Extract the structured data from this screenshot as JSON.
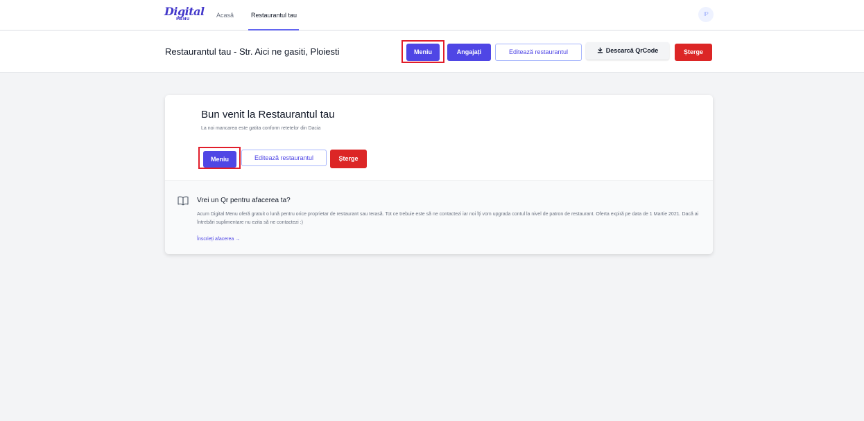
{
  "brand": {
    "name": "Digital",
    "tagline": "MENU"
  },
  "nav": {
    "items": [
      {
        "label": "Acasă"
      },
      {
        "label": "Restaurantul tau",
        "active": true
      }
    ],
    "user_initials": "IP"
  },
  "header": {
    "title": "Restaurantul tau - Str. Aici ne gasiti, Ploiesti",
    "buttons": {
      "menu": "Meniu",
      "employees": "Angajați",
      "edit": "Editează restaurantul",
      "download_qr": "Descarcă QrCode",
      "delete": "Șterge"
    }
  },
  "card": {
    "title": "Bun venit la Restaurantul tau",
    "subtitle": "La noi mancarea este gatita conform retetelor din Dacia",
    "buttons": {
      "menu": "Meniu",
      "edit": "Editează restaurantul",
      "delete": "Șterge"
    },
    "promo": {
      "icon": "book-open-icon",
      "title": "Vrei un Qr pentru afacerea ta?",
      "text": "Acum Digital Menu oferă gratuit o lună pentru orice proprietar de restaurant sau terasă. Tot ce trebuie este să ne contactezi iar noi îți vom upgrada contul la nivel de patron de restaurant. Oferta expiră pe data de 1 Martie 2021. Dacă ai întrebări suplimentare nu ezita să ne contactezi :)",
      "link": "Înscrieți afacerea →"
    }
  },
  "colors": {
    "primary": "#4f46e5",
    "danger": "#dc2626",
    "highlight": "#e11d2a",
    "background": "#f3f4f6"
  }
}
